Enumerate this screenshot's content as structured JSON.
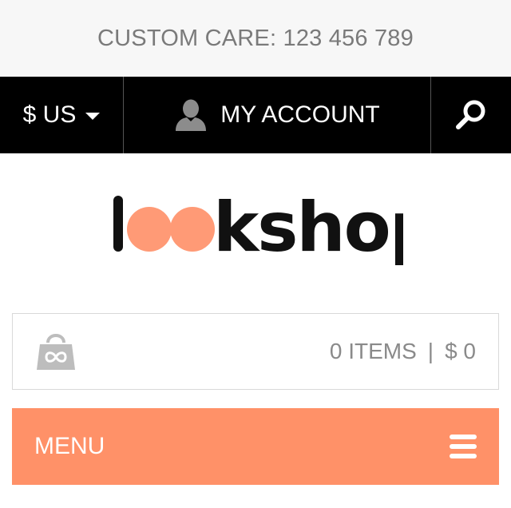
{
  "topbar": {
    "text": "CUSTOM CARE: 123 456 789"
  },
  "nav": {
    "currency_label": "$ US",
    "account_label": "MY ACCOUNT"
  },
  "logo": {
    "text": "lookshop",
    "accent_color": "#ff9168"
  },
  "cart": {
    "items_label": "0 ITEMS",
    "separator": "|",
    "total": "$ 0"
  },
  "menu": {
    "label": "MENU"
  },
  "colors": {
    "topbar_bg": "#f7f7f7",
    "nav_bg": "#000000",
    "accent": "#ff9168",
    "cart_icon": "#bdbdbd"
  }
}
